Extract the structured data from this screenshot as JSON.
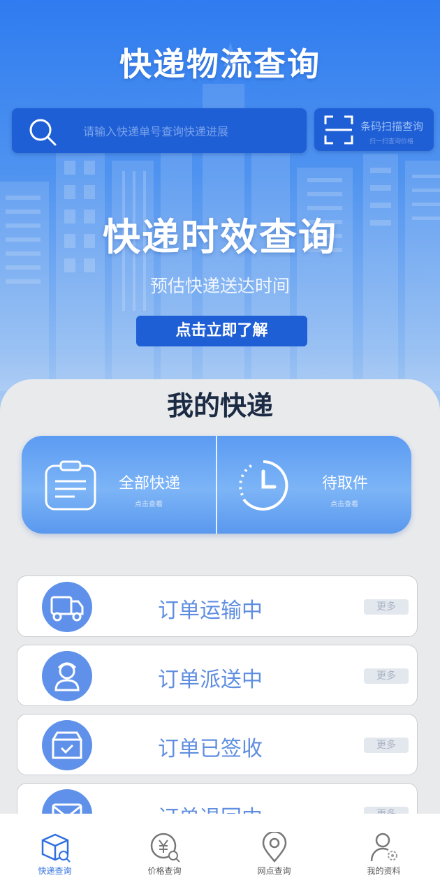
{
  "header": {
    "title": "快递物流查询"
  },
  "search": {
    "placeholder": "请输入快递单号查询快递进展"
  },
  "scan": {
    "title": "条码扫描查询",
    "subtitle": "扫一扫查询价格"
  },
  "banner": {
    "title": "快递时效查询",
    "subtitle": "预估快递送达时间",
    "button": "点击立即了解"
  },
  "my_express": {
    "title": "我的快递",
    "cards": [
      {
        "label": "全部快递",
        "sub": "点击查看",
        "icon": "clipboard-icon"
      },
      {
        "label": "待取件",
        "sub": "点击查看",
        "icon": "clock-icon"
      }
    ],
    "orders": [
      {
        "label": "订单运输中",
        "more": "更多",
        "icon": "truck-icon"
      },
      {
        "label": "订单派送中",
        "more": "更多",
        "icon": "courier-icon"
      },
      {
        "label": "订单已签收",
        "more": "更多",
        "icon": "package-check-icon"
      },
      {
        "label": "订单退回中",
        "more": "更多",
        "icon": "envelope-icon"
      }
    ]
  },
  "tabbar": {
    "items": [
      {
        "label": "快递查询",
        "icon": "box-search-icon",
        "active": true
      },
      {
        "label": "价格查询",
        "icon": "price-search-icon",
        "active": false
      },
      {
        "label": "网点查询",
        "icon": "location-pin-icon",
        "active": false
      },
      {
        "label": "我的资料",
        "icon": "user-gear-icon",
        "active": false
      }
    ]
  },
  "colors": {
    "primary": "#1f5fd6",
    "accent": "#5f91ea",
    "active_tab": "#2f6fe0"
  }
}
